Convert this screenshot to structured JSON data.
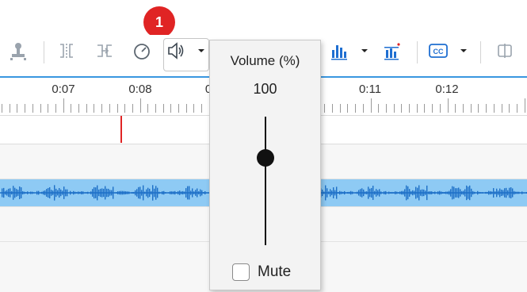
{
  "annotation": {
    "badge": "1"
  },
  "toolbar": {
    "icons": [
      "stamp-icon",
      "split-clip-icon",
      "swap-clip-icon",
      "speed-gauge-icon",
      "volume-icon",
      "audio-levels-icon",
      "audio-normalize-icon",
      "captions-icon",
      "split-view-icon"
    ]
  },
  "timeline": {
    "ruler_labels": [
      "0:07",
      "0:08",
      "0",
      "0:11",
      "0:12"
    ]
  },
  "volume_popup": {
    "title": "Volume (%)",
    "value": "100",
    "level": 0.8,
    "mute_label": "Mute",
    "mute_checked": false
  },
  "colors": {
    "accent": "#3a97e0",
    "waveform_bg": "#8ecaf4",
    "waveform": "#1d6fc7",
    "badge": "#e02424",
    "playhead": "#e02424"
  }
}
